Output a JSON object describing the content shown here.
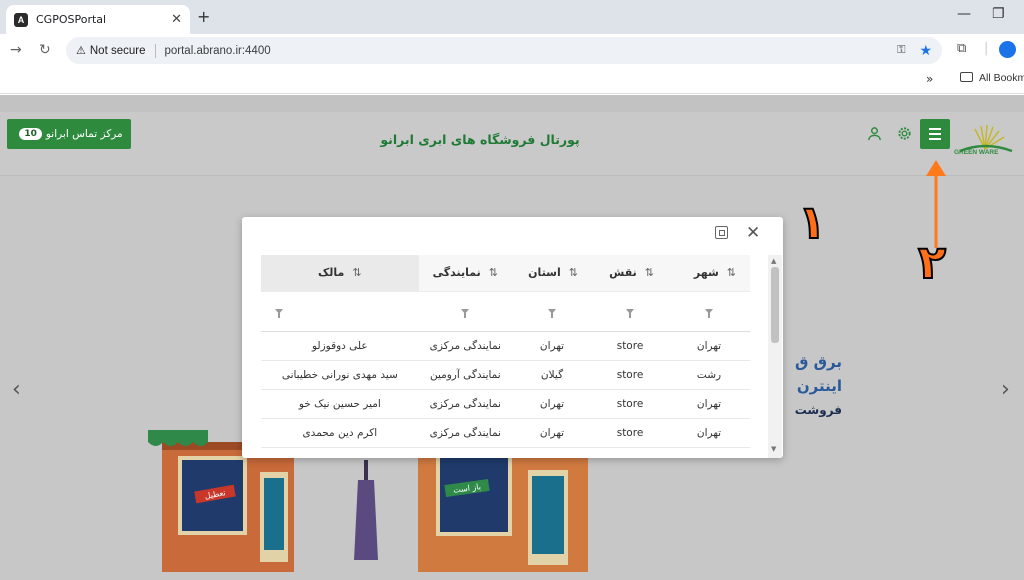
{
  "browser": {
    "tab_title": "CGPOSPortal",
    "tab_favicon": "A",
    "security_label": "Not secure",
    "url": "portal.abrano.ir:4400",
    "bookmarks_label": "All Bookm",
    "chevron": "»"
  },
  "header": {
    "contact_label": "مرکز تماس ابرانو",
    "contact_badge": "10",
    "title": "پورتال فروشگاه های ابری ابرانو",
    "logo_text": "GREEN WARE"
  },
  "promo": {
    "line1": "برق ق",
    "line2": "اینترن",
    "line3": "فروشت"
  },
  "annotations": {
    "one": "۱",
    "two": "۲",
    "arrow_color": "#ff7a1a"
  },
  "modal": {
    "columns": [
      "شهر",
      "نقش",
      "استان",
      "نمایندگی",
      "مالک"
    ],
    "rows": [
      [
        "تهران",
        "store",
        "تهران",
        "نمایندگی مرکزی",
        "علی دوقوزلو"
      ],
      [
        "رشت",
        "store",
        "گیلان",
        "نمایندگی آرومین",
        "سید مهدی نورانی خطیبانی"
      ],
      [
        "تهران",
        "store",
        "تهران",
        "نمایندگی مرکزی",
        "امیر حسین نیک خو"
      ],
      [
        "تهران",
        "store",
        "تهران",
        "نمایندگی مرکزی",
        "اکرم دین محمدی"
      ]
    ]
  },
  "illustration": {
    "sign_closed": "تعطیل",
    "sign_open": "باز است"
  },
  "colors": {
    "brand_green": "#2e8b3e",
    "link_blue": "#1a73e8",
    "annotation_orange": "#ff7a1a"
  }
}
